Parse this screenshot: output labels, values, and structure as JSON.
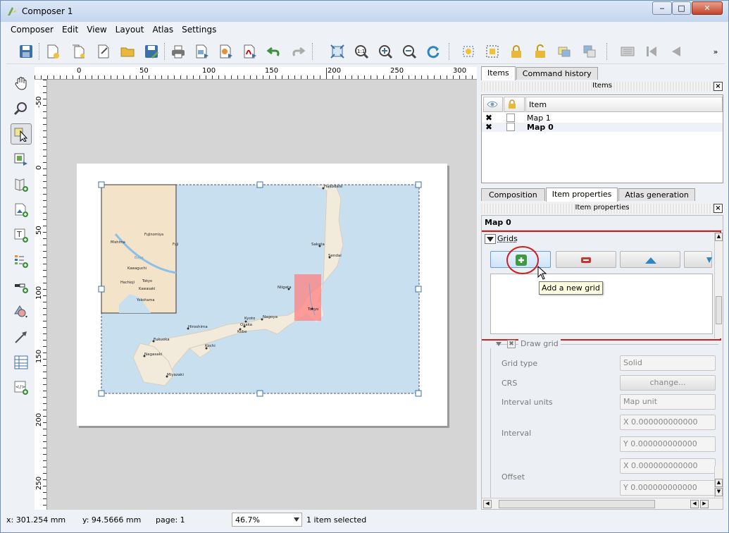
{
  "window": {
    "title": "Composer 1",
    "minimize": "‒",
    "maximize": "□",
    "close": "✕"
  },
  "menu": [
    "Composer",
    "Edit",
    "View",
    "Layout",
    "Atlas",
    "Settings"
  ],
  "toolbar": {
    "overflow": "»"
  },
  "rulers": {
    "h": [
      "0",
      "50",
      "100",
      "150",
      "200",
      "250",
      "300"
    ],
    "v": [
      "-50",
      "0",
      "50",
      "100",
      "150",
      "200",
      "250"
    ]
  },
  "map_labels": {
    "inset": [
      "Mishima",
      "Fujinomiya",
      "Fuji",
      "Kawaguchi",
      "Hachioji",
      "Tokyo",
      "Kawasaki",
      "Yokohama",
      "Bayo"
    ],
    "main": [
      "Hakodate",
      "Sakata",
      "Sendai",
      "Niigata",
      "Tokyo",
      "Nagoya",
      "Kyoto",
      "Osaka",
      "Kobe",
      "Hiroshima",
      "Fukuoka",
      "Nagasaki",
      "Kochi",
      "Miyazaki"
    ]
  },
  "panel": {
    "tabs": [
      "Items",
      "Command history"
    ],
    "items_header": "Items",
    "column_item": "Item",
    "items": [
      {
        "name": "Map 1",
        "visible": "✖"
      },
      {
        "name": "Map 0",
        "visible": "✖"
      }
    ],
    "lower_tabs": [
      "Composition",
      "Item properties",
      "Atlas generation"
    ],
    "props_header": "Item properties",
    "item_title": "Map 0",
    "grids_label": "Grids",
    "tooltip": "Add a new grid",
    "draw_grid": "Draw grid",
    "fields": {
      "grid_type_label": "Grid type",
      "grid_type_value": "Solid",
      "crs_label": "CRS",
      "crs_button": "change...",
      "interval_units_label": "Interval units",
      "interval_units_value": "Map unit",
      "interval_label": "Interval",
      "interval_x": "X 0.000000000000",
      "interval_y": "Y 0.000000000000",
      "offset_label": "Offset",
      "offset_x": "X 0.000000000000",
      "offset_y": "Y 0.000000000000"
    }
  },
  "status": {
    "x": "x: 301.254 mm",
    "y": "y: 94.5666 mm",
    "page": "page: 1",
    "zoom": "46.7%",
    "selected": "1 item selected"
  },
  "colors": {
    "highlight": "#cc2222",
    "sea": "#c8dff0",
    "land": "#f2ebdc",
    "selection_red": "#ff8080"
  }
}
